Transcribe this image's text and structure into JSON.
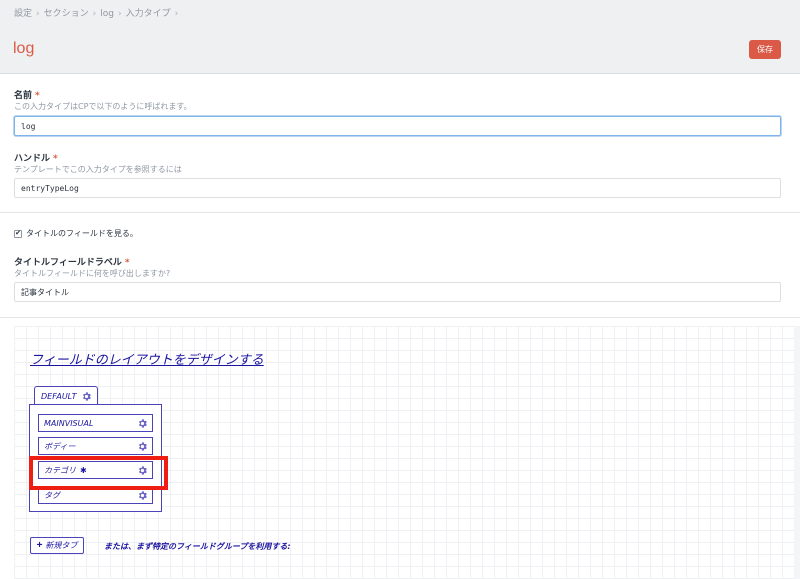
{
  "breadcrumb": [
    "設定",
    "セクション",
    "log",
    "入力タイプ"
  ],
  "page": {
    "title": "log",
    "save_label": "保存"
  },
  "name_field": {
    "label": "名前",
    "instructions": "この入力タイプはCPで以下のように呼ばれます。",
    "value": "log"
  },
  "handle_field": {
    "label": "ハンドル",
    "instructions": "テンプレートでこの入力タイプを参照するには",
    "value": "entryTypeLog"
  },
  "title_checkbox": {
    "label": "タイトルのフィールドを見る。",
    "checked": true
  },
  "title_label_field": {
    "label": "タイトルフィールドラベル",
    "instructions": "タイトルフィールドに何を呼び出しますか?",
    "value": "記事タイトル"
  },
  "layout": {
    "title": "フィールドのレイアウトをデザインする",
    "tab_name": "DEFAULT",
    "fields": [
      {
        "label": "MAINVISUAL",
        "required": false
      },
      {
        "label": "ボディー",
        "required": false
      },
      {
        "label": "カテゴリ",
        "required": true
      },
      {
        "label": "タグ",
        "required": false
      }
    ],
    "new_tab_label": "新規タブ",
    "alt_text": "または、まず特定のフィールドグループを利用する:"
  },
  "colors": {
    "accent": "#da5a47",
    "layout_ink": "#1a14a0",
    "highlight": "#ee1f12"
  },
  "icons": {
    "settings": "gear-icon",
    "add": "plus-icon"
  }
}
